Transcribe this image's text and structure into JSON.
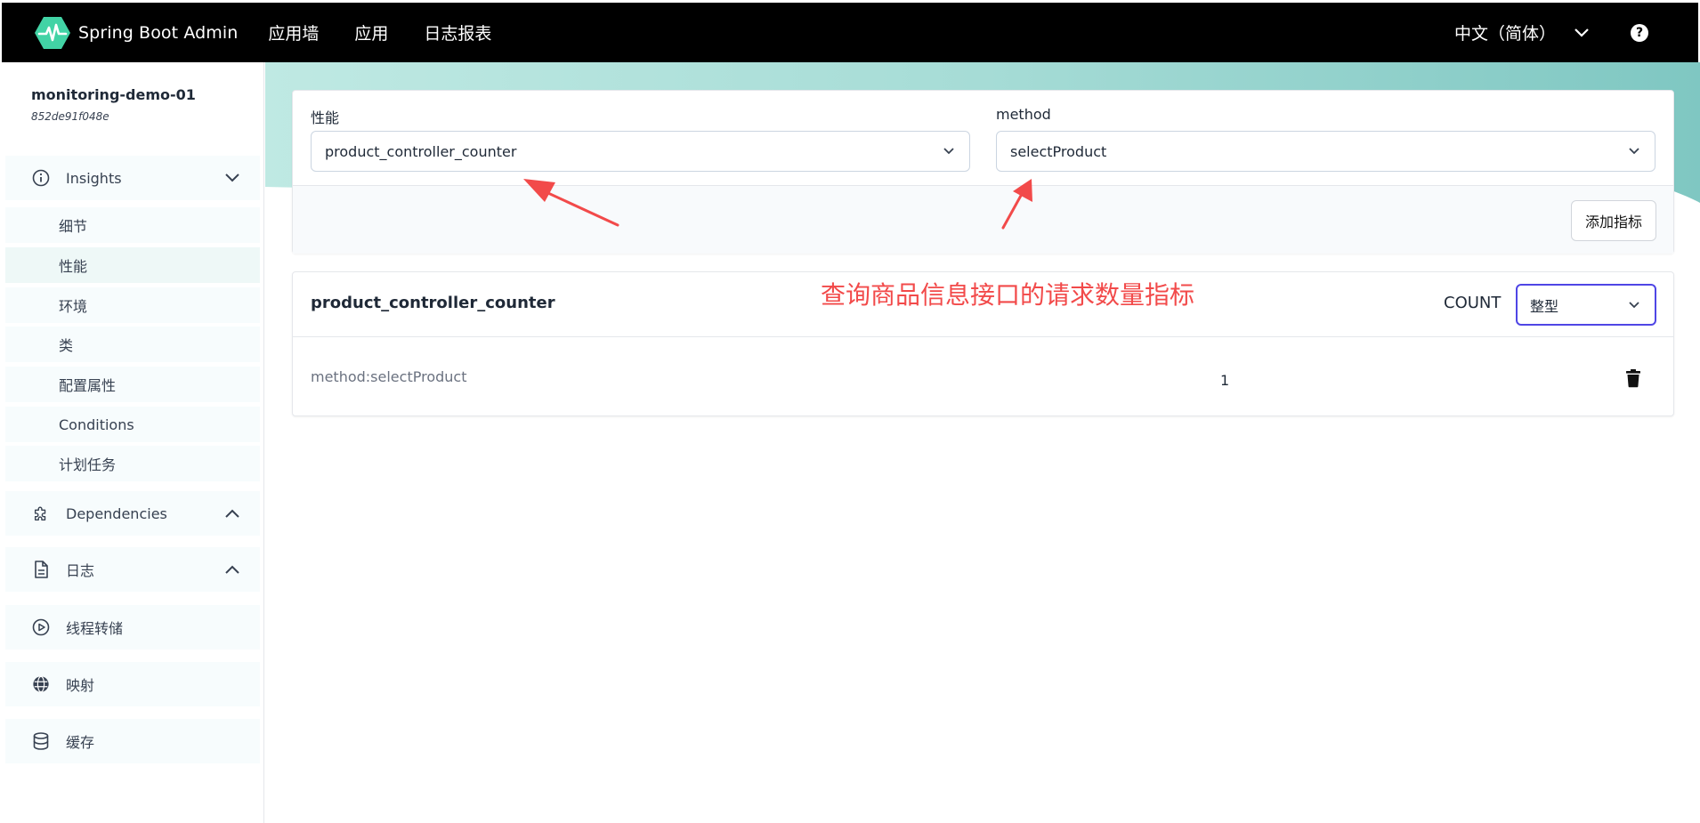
{
  "header": {
    "brand": "Spring Boot Admin",
    "nav": [
      "应用墙",
      "应用",
      "日志报表"
    ],
    "language": "中文（简体）",
    "help_icon_text": "?"
  },
  "sidebar": {
    "app_name": "monitoring-demo-01",
    "app_id": "852de91f048e",
    "insights": {
      "label": "Insights",
      "items": [
        "细节",
        "性能",
        "环境",
        "类",
        "配置属性",
        "Conditions",
        "计划任务"
      ],
      "active_item": "性能"
    },
    "groups": [
      {
        "label": "Dependencies",
        "icon": "puzzle-icon"
      },
      {
        "label": "日志",
        "icon": "document-icon"
      },
      {
        "label": "线程转储",
        "icon": "play-circle-icon"
      },
      {
        "label": "映射",
        "icon": "globe-icon"
      },
      {
        "label": "缓存",
        "icon": "database-icon"
      }
    ]
  },
  "filters": {
    "metric_label": "性能",
    "metric_value": "product_controller_counter",
    "tag_label": "method",
    "tag_value": "selectProduct",
    "add_button": "添加指标"
  },
  "metric_card": {
    "title": "product_controller_counter",
    "statistic": "COUNT",
    "format": "整型",
    "rows": [
      {
        "tag": "method:selectProduct",
        "value": "1"
      }
    ]
  },
  "annotation": {
    "text": "查询商品信息接口的请求数量指标",
    "color": "#f24a4a"
  },
  "colors": {
    "topbar": "#000000",
    "accent": "#42d3a5",
    "focus": "#4f46e5"
  }
}
